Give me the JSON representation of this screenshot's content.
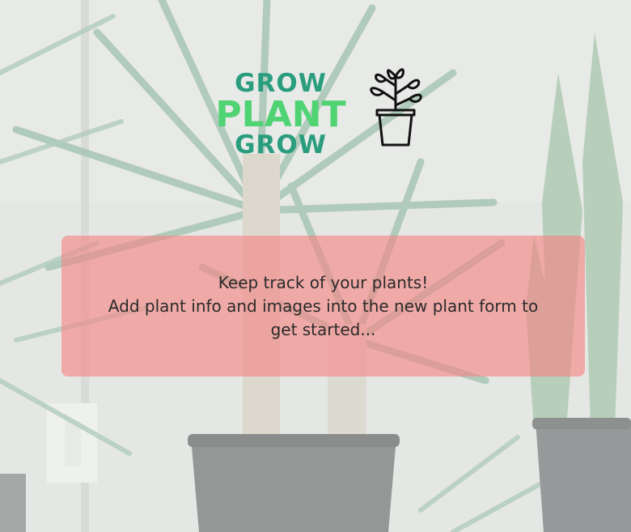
{
  "colors": {
    "logo_dark": "#2a9d7f",
    "logo_light": "#4fd373",
    "message_box": "rgba(246, 132, 132, 0.62)"
  },
  "logo": {
    "line1": "GROW",
    "line2": "PLANT",
    "line3": "GROW",
    "icon": "potted-plant-icon"
  },
  "message": {
    "line1": "Keep track of your plants!",
    "line2": "Add plant info and images into the new plant form to get started..."
  }
}
